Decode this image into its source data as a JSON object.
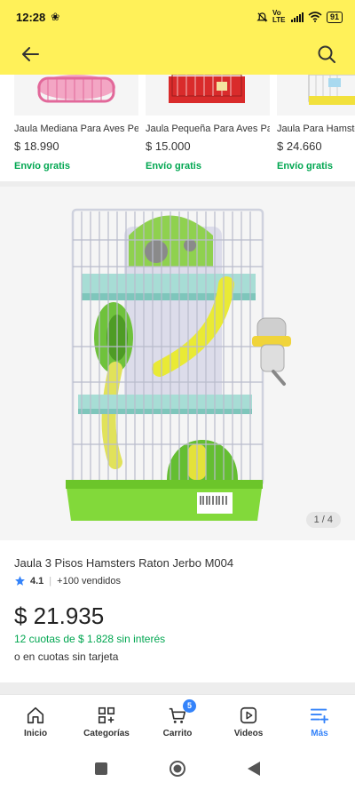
{
  "status_bar": {
    "time": "12:28",
    "fan_glyph": "❀",
    "network": "Vo LTE",
    "battery": "91"
  },
  "header": {
    "back_icon": "arrow-left-icon",
    "search_icon": "search-icon"
  },
  "related": [
    {
      "title": "Jaula Mediana Para Aves Pequeñas",
      "price": "$ 18.990",
      "shipping": "Envío gratis"
    },
    {
      "title": "Jaula Pequeña Para Aves Pajaros",
      "price": "$ 15.000",
      "shipping": "Envío gratis"
    },
    {
      "title": "Jaula Para Hamster",
      "price": "$ 24.660",
      "shipping": "Envío gratis"
    }
  ],
  "gallery": {
    "counter": "1 / 4"
  },
  "product": {
    "title": "Jaula 3 Pisos Hamsters Raton Jerbo M004",
    "rating": "4.1",
    "sold": "+100 vendidos",
    "price": "$ 21.935",
    "installments": "12 cuotas de $ 1.828 sin interés",
    "installments_alt": "o en cuotas sin tarjeta"
  },
  "bottom_nav": {
    "items": [
      {
        "label": "Inicio",
        "icon": "home-icon"
      },
      {
        "label": "Categorías",
        "icon": "categories-icon"
      },
      {
        "label": "Carrito",
        "icon": "cart-icon",
        "badge": "5"
      },
      {
        "label": "Videos",
        "icon": "video-icon"
      },
      {
        "label": "Más",
        "icon": "menu-plus-icon",
        "active": true
      }
    ]
  },
  "colors": {
    "brand_yellow": "#fff159",
    "accent_blue": "#3483fa",
    "green": "#00a650"
  }
}
